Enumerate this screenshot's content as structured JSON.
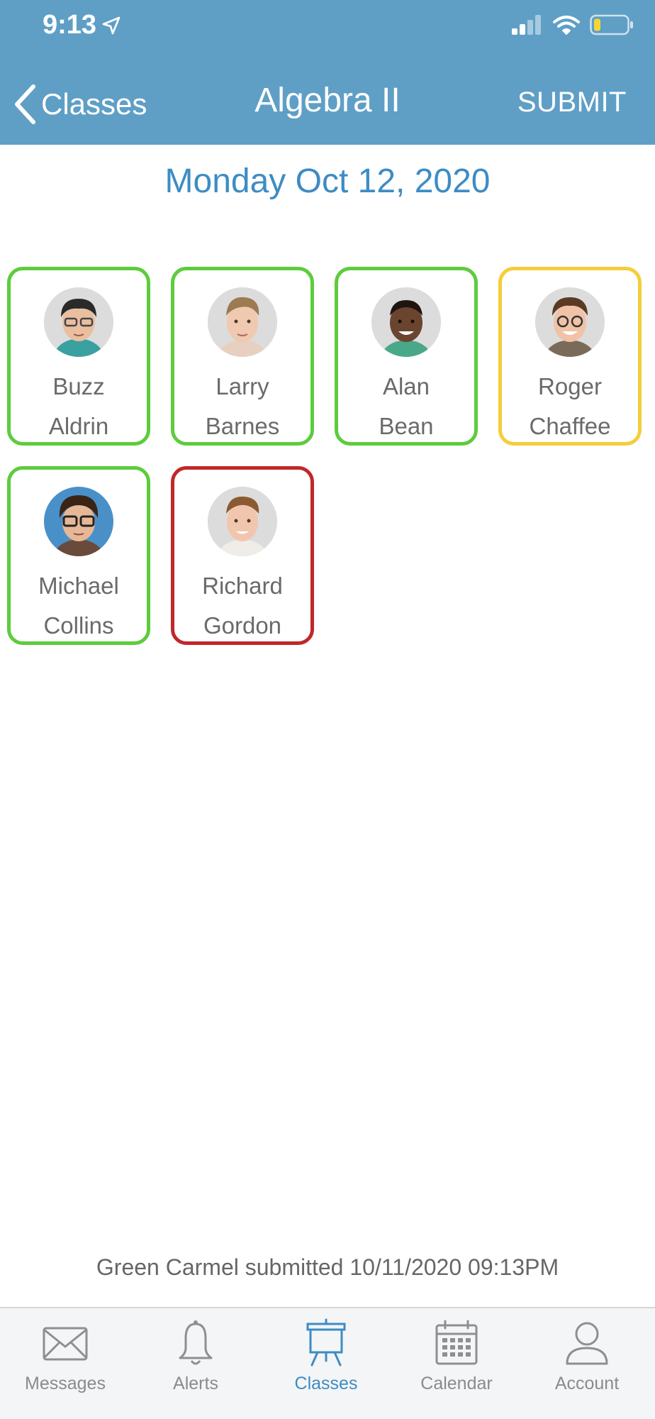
{
  "status_bar": {
    "time": "9:13"
  },
  "nav": {
    "back_label": "Classes",
    "title": "Algebra II",
    "submit_label": "SUBMIT"
  },
  "date_heading": "Monday Oct 12, 2020",
  "students": [
    {
      "first": "Buzz",
      "last": "Aldrin",
      "status_color": "#5dcc3c"
    },
    {
      "first": "Larry",
      "last": "Barnes",
      "status_color": "#5dcc3c"
    },
    {
      "first": "Alan",
      "last": "Bean",
      "status_color": "#5dcc3c"
    },
    {
      "first": "Roger",
      "last": "Chaffee",
      "status_color": "#f5cd3a"
    },
    {
      "first": "Michael",
      "last": "Collins",
      "status_color": "#5dcc3c"
    },
    {
      "first": "Richard",
      "last": "Gordon",
      "status_color": "#c0282a"
    }
  ],
  "submission_note": "Green Carmel submitted 10/11/2020 09:13PM",
  "tabs": [
    {
      "label": "Messages",
      "icon": "envelope-icon"
    },
    {
      "label": "Alerts",
      "icon": "bell-icon"
    },
    {
      "label": "Classes",
      "icon": "easel-icon",
      "active": true
    },
    {
      "label": "Calendar",
      "icon": "calendar-icon"
    },
    {
      "label": "Account",
      "icon": "user-icon"
    }
  ],
  "colors": {
    "header": "#5f9fc6",
    "accent": "#3d8cc4",
    "present": "#5dcc3c",
    "late": "#f5cd3a",
    "absent": "#c0282a"
  }
}
